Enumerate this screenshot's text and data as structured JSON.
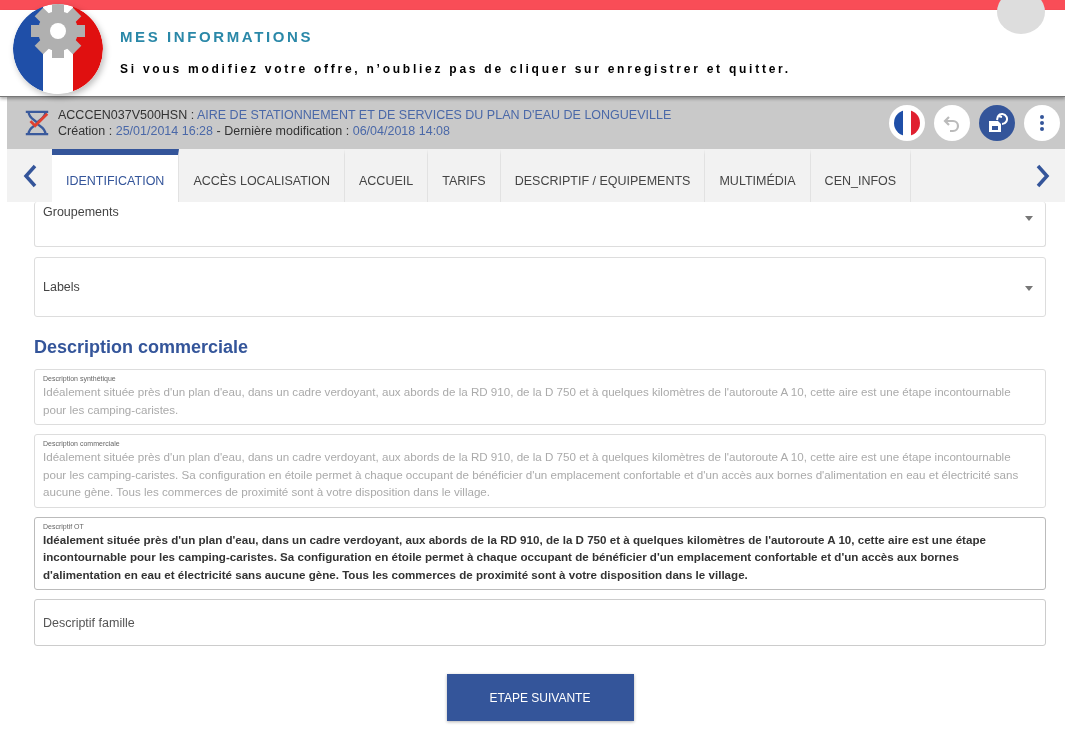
{
  "header": {
    "title": "MES INFORMATIONS",
    "notice": "Si vous modifiez votre offre, n’oubliez pas de cliquer sur enregistrer et quitter."
  },
  "record": {
    "code": "ACCCEN037V500HSN :",
    "name": "AIRE DE STATIONNEMENT ET DE SERVICES DU PLAN D'EAU DE LONGUEVILLE",
    "creation_label": "Création :",
    "creation_date": "25/01/2014 16:28",
    "separator": "-",
    "modified_label": "Dernière modification :",
    "modified_date": "06/04/2018 14:08"
  },
  "tabs": [
    {
      "label": "IDENTIFICATION",
      "selected": true
    },
    {
      "label": "ACCÈS LOCALISATION",
      "selected": false
    },
    {
      "label": "ACCUEIL",
      "selected": false
    },
    {
      "label": "TARIFS",
      "selected": false
    },
    {
      "label": "DESCRIPTIF / EQUIPEMENTS",
      "selected": false
    },
    {
      "label": "MULTIMÉDIA",
      "selected": false
    },
    {
      "label": "CEN_INFOS",
      "selected": false
    }
  ],
  "selects": [
    {
      "label": "Groupements"
    },
    {
      "label": "Labels"
    }
  ],
  "section_title": "Description commerciale",
  "fields": [
    {
      "kind": "textarea",
      "label": "Description synthétique",
      "disabled": true,
      "value": "Idéalement située près d'un plan d'eau, dans un cadre verdoyant, aux abords de la RD 910, de la D 750 et à quelques kilomètres de l'autoroute A 10, cette aire est une étape incontournable pour les camping-caristes."
    },
    {
      "kind": "textarea",
      "label": "Description commerciale",
      "disabled": true,
      "value": "Idéalement située près d'un plan d'eau, dans un cadre verdoyant, aux abords de la RD 910, de la D 750 et à quelques kilomètres de l'autoroute A 10, cette aire est une étape incontournable pour les camping-caristes. Sa configuration en étoile permet à chaque occupant de bénéficier d'un emplacement confortable et d'un accès aux bornes d'alimentation en eau et électricité sans aucune gène. Tous les commerces de proximité sont à votre disposition dans le village."
    },
    {
      "kind": "textarea",
      "label": "Descriptif OT",
      "disabled": false,
      "value": "Idéalement située près d'un plan d'eau, dans un cadre verdoyant, aux abords de la RD 910, de la D 750 et à quelques kilomètres de l'autoroute A 10, cette aire est une étape incontournable pour les camping-caristes. Sa configuration en étoile permet à chaque occupant de bénéficier d'un emplacement confortable et d'un accès aux bornes d'alimentation en eau et électricité sans aucune gène. Tous les commerces de proximité sont à votre disposition dans le village."
    },
    {
      "kind": "input",
      "placeholder": "Descriptif famille"
    }
  ],
  "next_button": "ETAPE SUIVANTE"
}
